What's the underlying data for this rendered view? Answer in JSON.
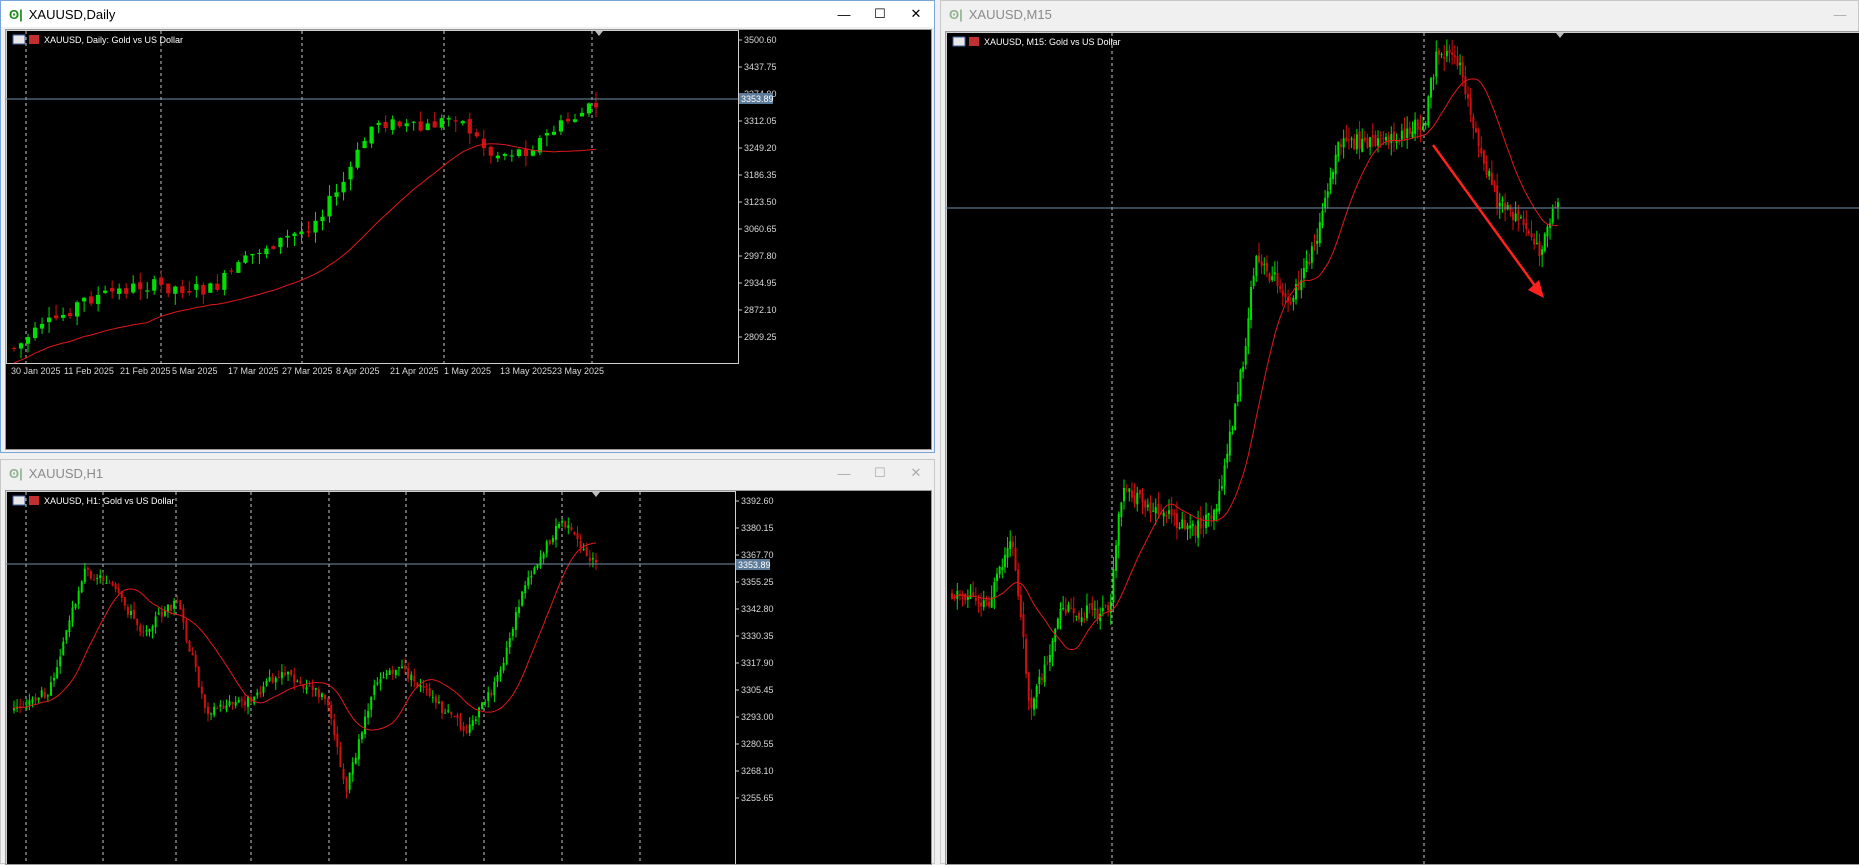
{
  "windows": [
    {
      "id": "daily",
      "title": "XAUUSD,Daily",
      "label_symbol": "XAUUSD, Daily:  Gold vs US Dollar",
      "active": true,
      "price_labels": [
        "3500.60",
        "3437.75",
        "3374.90",
        "3312.05",
        "3249.20",
        "3186.35",
        "3123.50",
        "3060.65",
        "2997.80",
        "2934.95",
        "2872.10",
        "2809.25"
      ],
      "current_price": "3353.89",
      "date_labels": [
        "30 Jan 2025",
        "11 Feb 2025",
        "21 Feb 2025",
        "5 Mar 2025",
        "17 Mar 2025",
        "27 Mar 2025",
        "8 Apr 2025",
        "21 Apr 2025",
        "1 May 2025",
        "13 May 2025",
        "23 May 2025"
      ]
    },
    {
      "id": "h1",
      "title": "XAUUSD,H1",
      "label_symbol": "XAUUSD, H1:  Gold vs US Dollar",
      "active": false,
      "price_labels": [
        "3392.60",
        "3380.15",
        "3367.70",
        "3355.25",
        "3342.80",
        "3330.35",
        "3317.90",
        "3305.45",
        "3293.00",
        "3280.55",
        "3268.10",
        "3255.65"
      ],
      "current_price": "3353.89"
    },
    {
      "id": "m15",
      "title": "XAUUSD,M15",
      "label_symbol": "XAUUSD, M15:  Gold vs US Dollar",
      "active": false
    }
  ],
  "window_buttons": {
    "minimize": "—",
    "maximize": "☐",
    "close": "✕"
  },
  "colors": {
    "bull": "#00e000",
    "bear": "#d01010",
    "ma": "#e01818",
    "grid": "#c8c8c8",
    "price_line": "#6f8fa8",
    "arrow": "#ff2020"
  }
}
